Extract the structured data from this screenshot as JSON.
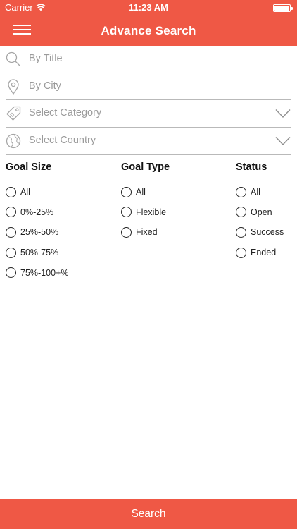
{
  "status_bar": {
    "carrier": "Carrier",
    "time": "11:23 AM"
  },
  "nav": {
    "title": "Advance Search"
  },
  "fields": {
    "title_placeholder": "By Title",
    "city_placeholder": "By City",
    "category_label": "Select Category",
    "country_label": "Select Country"
  },
  "filters": {
    "goal_size": {
      "heading": "Goal Size",
      "options": [
        "All",
        "0%-25%",
        "25%-50%",
        "50%-75%",
        "75%-100+%"
      ]
    },
    "goal_type": {
      "heading": "Goal Type",
      "options": [
        "All",
        "Flexible",
        "Fixed"
      ]
    },
    "status": {
      "heading": "Status",
      "options": [
        "All",
        "Open",
        "Success",
        "Ended"
      ]
    }
  },
  "search_button": {
    "label": "Search"
  },
  "colors": {
    "accent": "#ef5845",
    "field_text": "#9b9b9b",
    "divider": "#b9b9b9"
  }
}
